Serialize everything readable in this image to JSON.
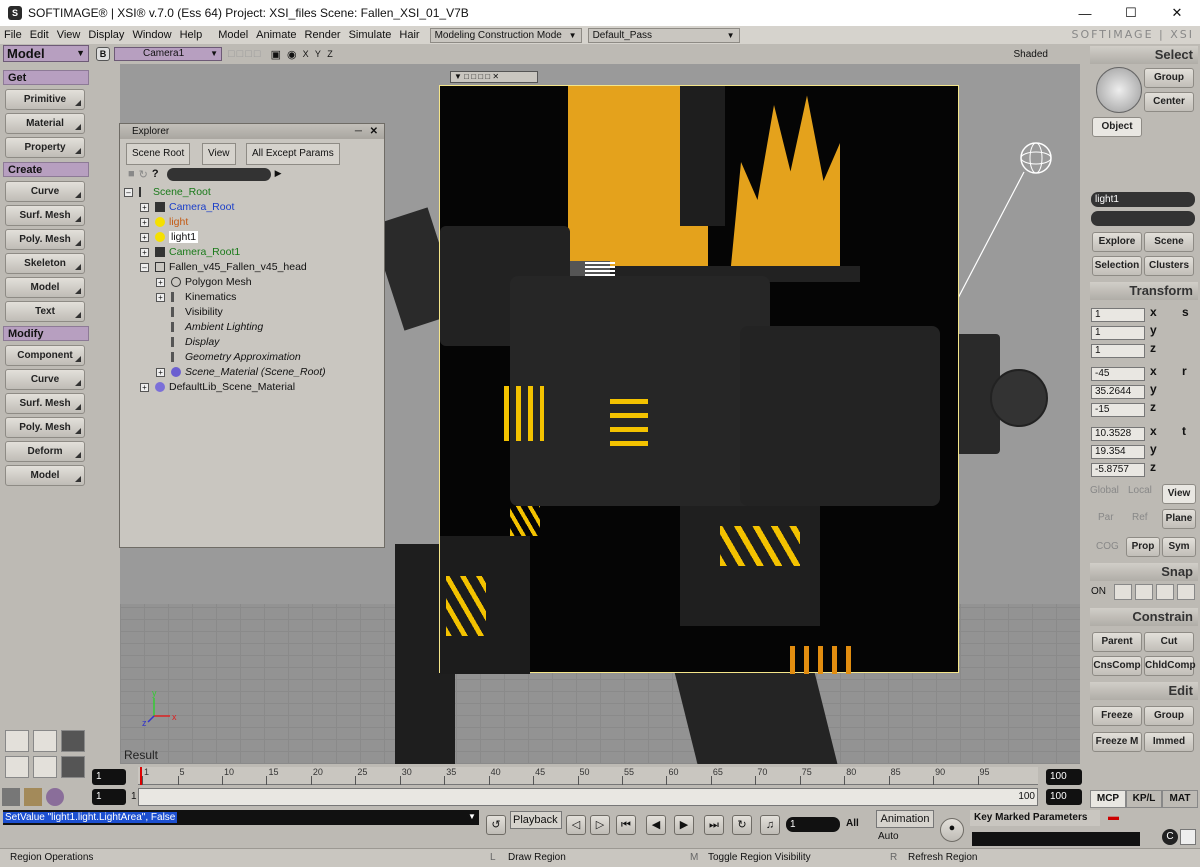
{
  "app": {
    "title": "SOFTIMAGE® | XSI® v.7.0 (Ess 64) Project: XSI_files   Scene: Fallen_XSI_01_V7B",
    "brand": "SOFTIMAGE | XSI"
  },
  "menu": [
    "File",
    "Edit",
    "View",
    "Display",
    "Window",
    "Help",
    "Model",
    "Animate",
    "Render",
    "Simulate",
    "Hair"
  ],
  "mode_combo": "Modeling Construction Mode",
  "pass_combo": "Default_Pass",
  "left": {
    "module": "Model",
    "get_header": "Get",
    "get_buttons": [
      "Primitive",
      "Material",
      "Property"
    ],
    "create_header": "Create",
    "create_buttons": [
      "Curve",
      "Surf. Mesh",
      "Poly. Mesh",
      "Skeleton",
      "Model",
      "Text"
    ],
    "modify_header": "Modify",
    "modify_buttons": [
      "Component",
      "Curve",
      "Surf. Mesh",
      "Poly. Mesh",
      "Deform",
      "Model"
    ]
  },
  "viewport": {
    "letter": "B",
    "camera": "Camera1",
    "axes": "X Y Z",
    "shading": "Shaded",
    "result_label": "Result"
  },
  "explorer": {
    "title": "Explorer",
    "btn_scope": "Scene Root",
    "btn_view": "View",
    "btn_filter": "All Except Params",
    "tree": [
      {
        "label": "Scene_Root",
        "color": "#1a7a1a"
      },
      {
        "label": "Camera_Root",
        "color": "#1a3ec9"
      },
      {
        "label": "light",
        "color": "#c45b15"
      },
      {
        "label": "light1",
        "color": "#111111"
      },
      {
        "label": "Camera_Root1",
        "color": "#1a7a1a"
      },
      {
        "label": "Fallen_v45_Fallen_v45_head",
        "color": "#111111"
      },
      {
        "label": "Polygon Mesh",
        "color": "#111111"
      },
      {
        "label": "Kinematics",
        "color": "#111111"
      },
      {
        "label": "Visibility",
        "color": "#111111"
      },
      {
        "label": "Ambient Lighting",
        "color": "#111111"
      },
      {
        "label": "Display",
        "color": "#111111"
      },
      {
        "label": "Geometry Approximation",
        "color": "#111111"
      },
      {
        "label": "Scene_Material (Scene_Root)",
        "color": "#111111"
      },
      {
        "label": "DefaultLib_Scene_Material",
        "color": "#111111"
      }
    ]
  },
  "right": {
    "select_header": "Select",
    "group": "Group",
    "center": "Center",
    "object": "Object",
    "selected_name": "light1",
    "explore": "Explore",
    "scene": "Scene",
    "selection": "Selection",
    "clusters": "Clusters",
    "transform_header": "Transform",
    "scale": [
      "1",
      "1",
      "1"
    ],
    "rotate": [
      "-45",
      "35.2644",
      "-15"
    ],
    "translate": [
      "10.3528",
      "19.354",
      "-5.8757"
    ],
    "axis_x": "x",
    "axis_y": "y",
    "axis_z": "z",
    "scale_letter": "s",
    "rotate_letter": "r",
    "translate_letter": "t",
    "global": "Global",
    "local": "Local",
    "view": "View",
    "par": "Par",
    "ref": "Ref",
    "plane": "Plane",
    "cog": "COG",
    "prop": "Prop",
    "sym": "Sym",
    "snap_header": "Snap",
    "snap_on": "ON",
    "constrain_header": "Constrain",
    "parent": "Parent",
    "cut": "Cut",
    "cnscomp": "CnsComp",
    "chldcomp": "ChldComp",
    "edit_header": "Edit",
    "freeze": "Freeze",
    "group2": "Group",
    "freeze_m": "Freeze M",
    "immed": "Immed",
    "tabs": [
      "MCP",
      "KP/L",
      "MAT"
    ]
  },
  "timeline": {
    "start": "1",
    "end": "100",
    "range_start": "1",
    "range_end": "100",
    "range_end2": "100",
    "end2": "100",
    "ticks": [
      "1",
      "5",
      "10",
      "15",
      "20",
      "25",
      "30",
      "35",
      "40",
      "45",
      "50",
      "55",
      "60",
      "65",
      "70",
      "75",
      "80",
      "85",
      "90",
      "95"
    ]
  },
  "playback": {
    "label": "Playback",
    "frame": "1",
    "all": "All",
    "animation": "Animation",
    "auto": "Auto",
    "key_marked": "Key Marked Parameters"
  },
  "command": {
    "text": "SetValue \"light1.light.LightArea\", False"
  },
  "status": {
    "left": "Region Operations",
    "l": "L",
    "l_text": "Draw Region",
    "m": "M",
    "m_text": "Toggle Region Visibility",
    "r": "R",
    "r_text": "Refresh Region"
  }
}
